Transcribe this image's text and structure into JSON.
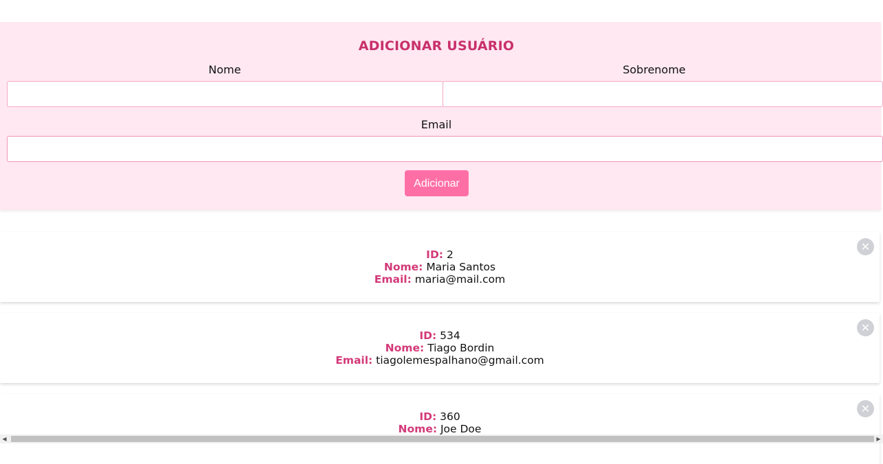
{
  "form": {
    "title": "ADICIONAR USUÁRIO",
    "first_name_label": "Nome",
    "last_name_label": "Sobrenome",
    "email_label": "Email",
    "first_name_value": "",
    "last_name_value": "",
    "email_value": "",
    "submit_label": "Adicionar"
  },
  "labels": {
    "id": "ID:",
    "name": "Nome:",
    "email": "Email:"
  },
  "users": [
    {
      "id": "2",
      "name": "Maria Santos",
      "email": "maria@mail.com"
    },
    {
      "id": "534",
      "name": "Tiago Bordin",
      "email": "tiagolemespalhano@gmail.com"
    },
    {
      "id": "360",
      "name": "Joe Doe",
      "email": ""
    }
  ],
  "icons": {
    "delete": "close-circle-icon",
    "scroll_left": "arrow-left-icon",
    "scroll_right": "arrow-right-icon"
  },
  "colors": {
    "accent": "#c8306b",
    "label": "#d33a79",
    "panel_bg": "#ffe8f1",
    "button_bg": "#ff6fa6"
  }
}
